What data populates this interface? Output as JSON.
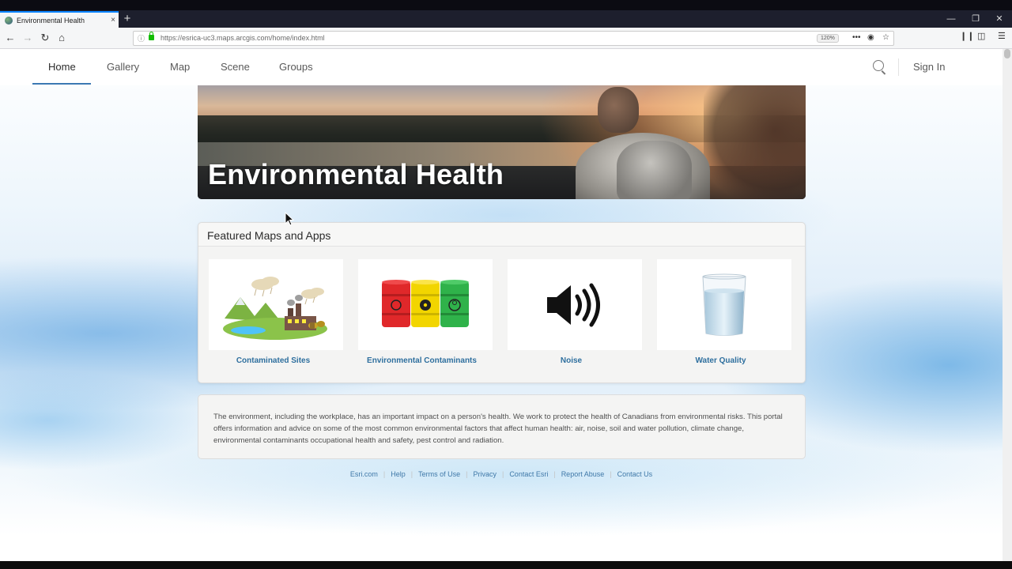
{
  "browser": {
    "tab_title": "Environmental Health",
    "tab_close": "×",
    "new_tab": "+",
    "url": "https://esrica-uc3.maps.arcgis.com/home/index.html",
    "zoom": "120%",
    "win_min": "—",
    "win_restore": "❐",
    "win_close": "✕"
  },
  "nav": {
    "items": [
      "Home",
      "Gallery",
      "Map",
      "Scene",
      "Groups"
    ],
    "sign_in": "Sign In"
  },
  "banner": {
    "title": "Environmental Health"
  },
  "featured": {
    "heading": "Featured Maps and Apps",
    "cards": [
      {
        "label": "Contaminated Sites",
        "icon": "polluted-landscape-icon"
      },
      {
        "label": "Environmental Contaminants",
        "icon": "chemical-barrels-icon"
      },
      {
        "label": "Noise",
        "icon": "speaker-icon"
      },
      {
        "label": "Water Quality",
        "icon": "water-glass-icon"
      }
    ]
  },
  "description": "The environment, including the workplace, has an important impact on a person's health. We work to protect the health of Canadians from environmental risks. This portal offers information and advice on some of the most common environmental factors that affect human health: air, noise, soil and water pollution, climate change, environmental contaminants occupational health and safety, pest control and radiation.",
  "footer": {
    "links": [
      "Esri.com",
      "Help",
      "Terms of Use",
      "Privacy",
      "Contact Esri",
      "Report Abuse",
      "Contact Us"
    ]
  },
  "colors": {
    "accent": "#3b79b3",
    "link": "#2e6f9e",
    "barrel_red": "#e0282a",
    "barrel_yellow": "#f2d500",
    "barrel_green": "#2fb24a"
  }
}
